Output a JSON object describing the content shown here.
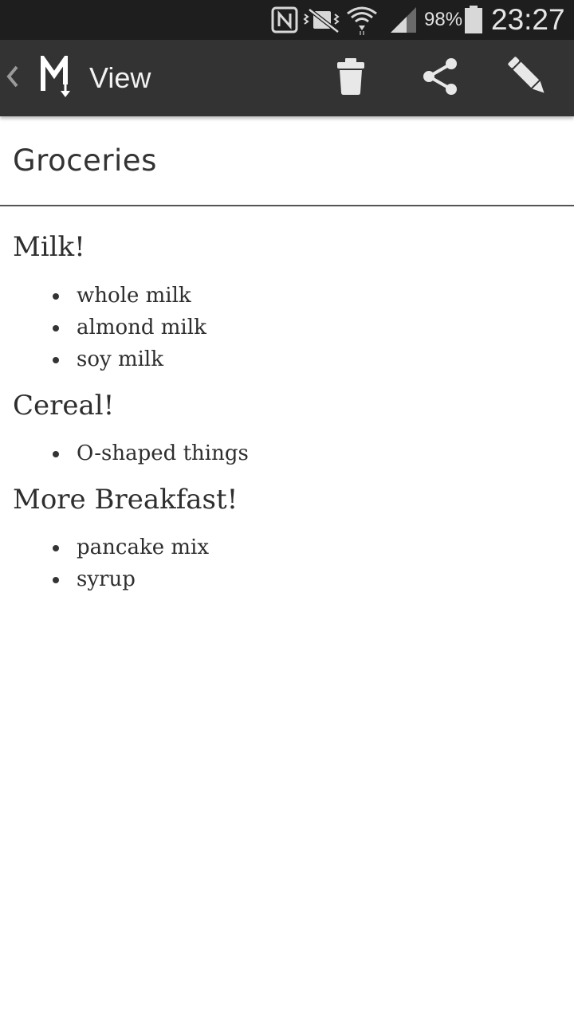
{
  "status_bar": {
    "battery_percent": "98%",
    "time": "23:27",
    "icons": [
      "nfc-icon",
      "vibrate-icon",
      "wifi-icon",
      "cell-signal-icon",
      "battery-icon"
    ]
  },
  "action_bar": {
    "back_icon": "chevron-left-icon",
    "logo_icon": "markdown-logo-icon",
    "title": "View",
    "actions": [
      "trash-icon",
      "share-icon",
      "pencil-icon"
    ],
    "background": "#333333"
  },
  "document": {
    "title": "Groceries",
    "sections": [
      {
        "heading": "Milk!",
        "items": [
          "whole milk",
          "almond milk",
          "soy milk"
        ]
      },
      {
        "heading": "Cereal!",
        "items": [
          "O-shaped things"
        ]
      },
      {
        "heading": "More Breakfast!",
        "items": [
          "pancake mix",
          "syrup"
        ]
      }
    ]
  }
}
